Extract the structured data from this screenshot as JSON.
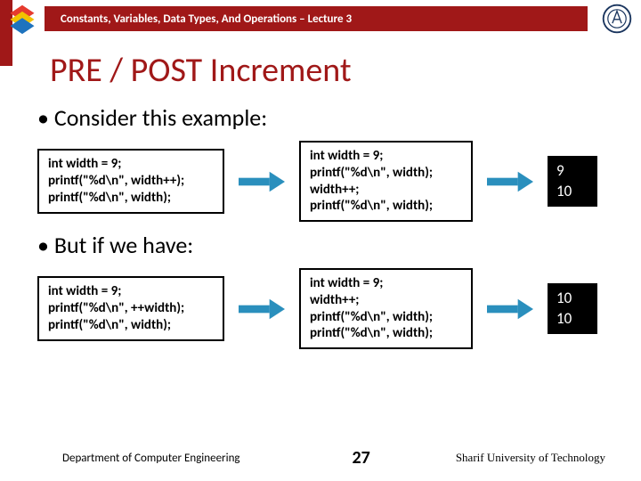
{
  "header": {
    "lecture_title": "Constants, Variables, Data Types, And Operations – Lecture 3"
  },
  "title": "PRE / POST Increment",
  "bullets": {
    "b1": "• Consider this example:",
    "b2": "• But if we have:"
  },
  "code": {
    "r1_left": "int width = 9;\nprintf(\"%d\\n\", width++);\nprintf(\"%d\\n\", width);",
    "r1_mid": "int width = 9;\nprintf(\"%d\\n\", width);\nwidth++;\nprintf(\"%d\\n\", width);",
    "r1_out": "9\n10",
    "r2_left": "int width = 9;\nprintf(\"%d\\n\", ++width);\nprintf(\"%d\\n\", width);",
    "r2_mid": "int width = 9;\nwidth++;\nprintf(\"%d\\n\", width);\nprintf(\"%d\\n\", width);",
    "r2_out": "10\n10"
  },
  "footer": {
    "department": "Department of Computer Engineering",
    "page": "27",
    "university": "Sharif University of Technology"
  }
}
